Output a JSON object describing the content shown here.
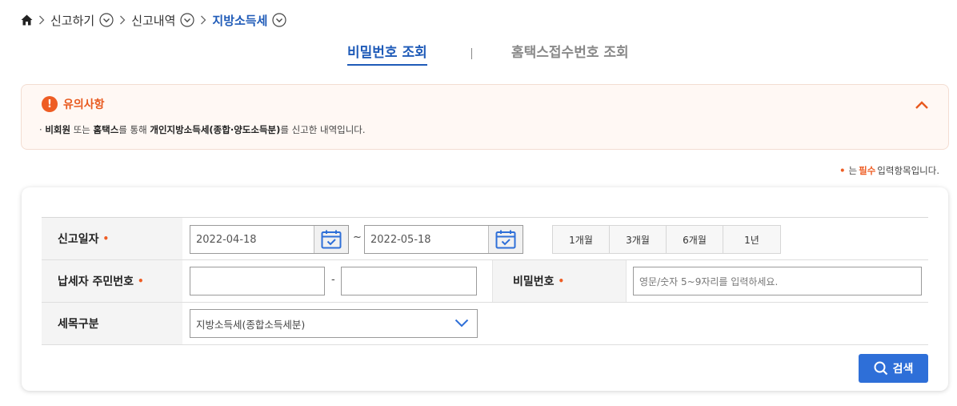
{
  "breadcrumb": {
    "home_icon": "home-icon",
    "items": [
      {
        "label": "신고하기"
      },
      {
        "label": "신고내역"
      },
      {
        "label": "지방소득세"
      }
    ]
  },
  "tabs": [
    {
      "label": "비밀번호 조회",
      "active": true
    },
    {
      "label": "홈택스접수번호 조회",
      "active": false
    }
  ],
  "notice": {
    "title": "유의사항",
    "bullet": "·",
    "text_parts": {
      "p1": "비회원",
      "p2": " 또는 ",
      "p3": "홈택스",
      "p4": "를 통해 ",
      "p5": "개인지방소득세(종합·양도소득분)",
      "p6": "를 신고한 내역입니다."
    }
  },
  "required_note": {
    "dot": "•",
    "prefix": "는",
    "keyword": "필수",
    "suffix": "입력항목입니다."
  },
  "form": {
    "report_date": {
      "label": "신고일자",
      "star": "•",
      "from": "2022-04-18",
      "tilde": "~",
      "to": "2022-05-18",
      "periods": [
        "1개월",
        "3개월",
        "6개월",
        "1년"
      ]
    },
    "taxpayer_id": {
      "label": "납세자 주민번호",
      "star": "•",
      "front": "",
      "dash": "-",
      "back": ""
    },
    "password": {
      "label": "비밀번호",
      "star": "•",
      "placeholder": "영문/숫자 5~9자리를 입력하세요."
    },
    "tax_type": {
      "label": "세목구분",
      "selected": "지방소득세(종합소득세분)"
    },
    "search_button": "검색"
  },
  "colors": {
    "accent_blue": "#1f5bb8",
    "button_blue": "#2e6fd8",
    "alert_orange": "#ee5d24",
    "notice_bg": "#fff8f4"
  }
}
